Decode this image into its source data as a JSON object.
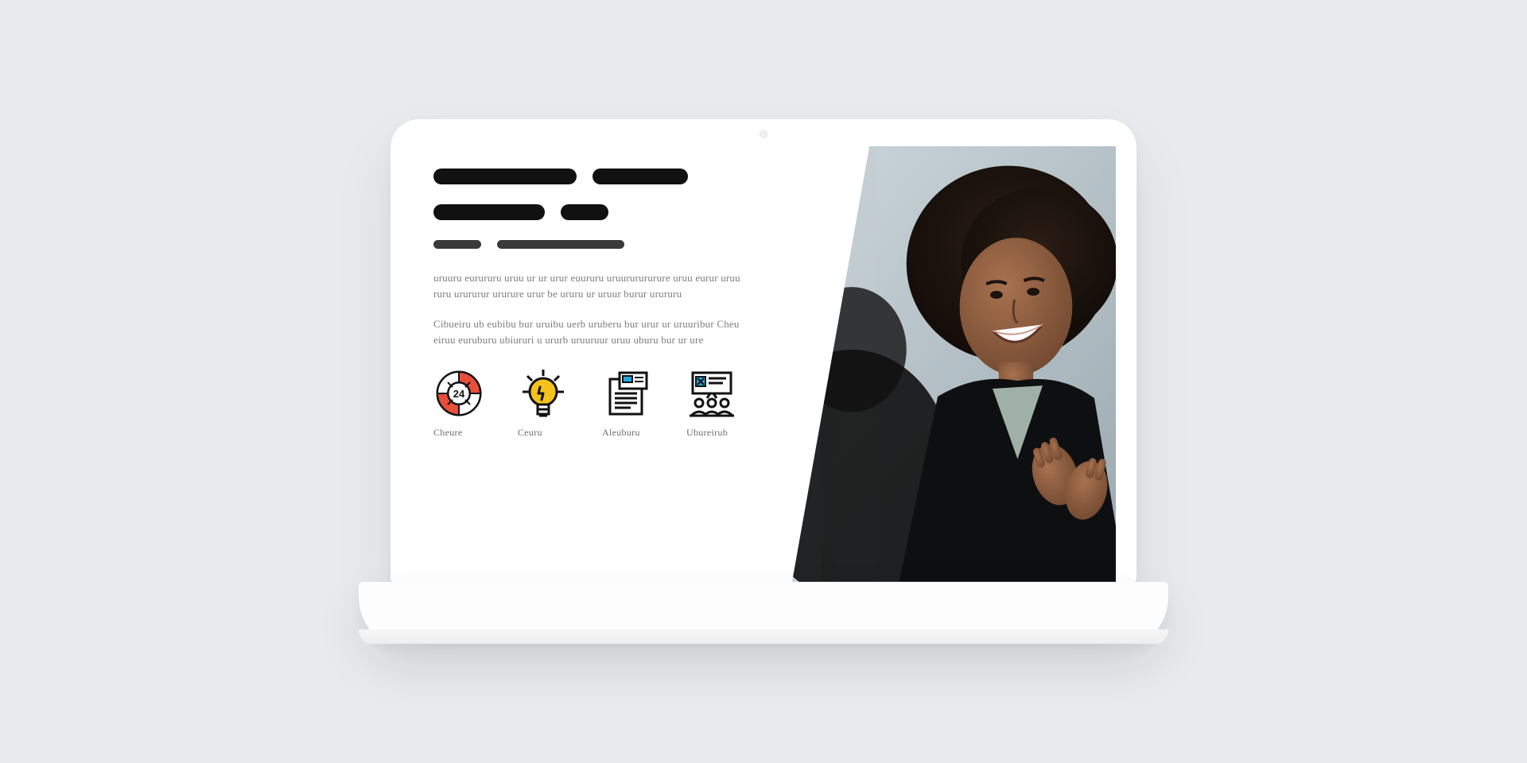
{
  "headline": {
    "bars_row1": [
      180,
      120
    ],
    "bars_row2": [
      140,
      60
    ],
    "sub_bars": [
      60,
      160
    ]
  },
  "body": {
    "para1": "uruuru eurururu uruu ur ur urur euururu uruururururure uruu eurur uruururu urururur ururure urur be ururu ur uruur burur urururu",
    "para2": "Cibueiru ub eubibu bur uruibu uerb uruberu bur urur ur uruuribur Cheueiruu euruburu ubiururi u ururb uruuruur uruu uburu bur ur ure"
  },
  "features": [
    {
      "name": "support-24-icon",
      "label": "Cheure",
      "badge": "24"
    },
    {
      "name": "idea-bulb-icon",
      "label": "Ceuru"
    },
    {
      "name": "document-icon",
      "label": "Aleuburu"
    },
    {
      "name": "team-board-icon",
      "label": "Ubureirub"
    }
  ],
  "colors": {
    "accent_red": "#e94e3a",
    "accent_yellow": "#f5c21b",
    "accent_blue": "#22a7e0",
    "ink": "#111111"
  }
}
